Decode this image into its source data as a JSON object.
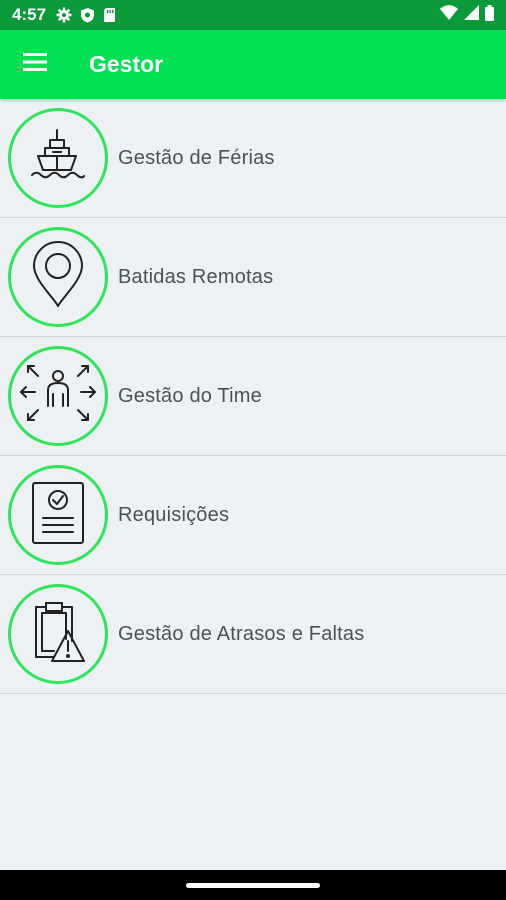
{
  "status_bar": {
    "time": "4:57",
    "left_icons": [
      "gear-icon",
      "shield-icon",
      "sd-card-icon"
    ],
    "right_icons": [
      "wifi-icon",
      "signal-icon",
      "battery-icon"
    ]
  },
  "app_bar": {
    "title": "Gestor",
    "menu_icon": "hamburger-menu-icon",
    "background": "#00e052"
  },
  "menu_items": [
    {
      "label": "Gestão de Férias",
      "icon": "ship-icon"
    },
    {
      "label": "Batidas Remotas",
      "icon": "map-pin-icon"
    },
    {
      "label": "Gestão do Time",
      "icon": "team-expand-icon"
    },
    {
      "label": "Requisições",
      "icon": "document-check-icon"
    },
    {
      "label": "Gestão de Atrasos e Faltas",
      "icon": "clipboard-warning-icon"
    }
  ],
  "colors": {
    "accent_ring": "#2ee65a",
    "status_bar": "#0a9a3a",
    "background": "#eef1f4"
  }
}
